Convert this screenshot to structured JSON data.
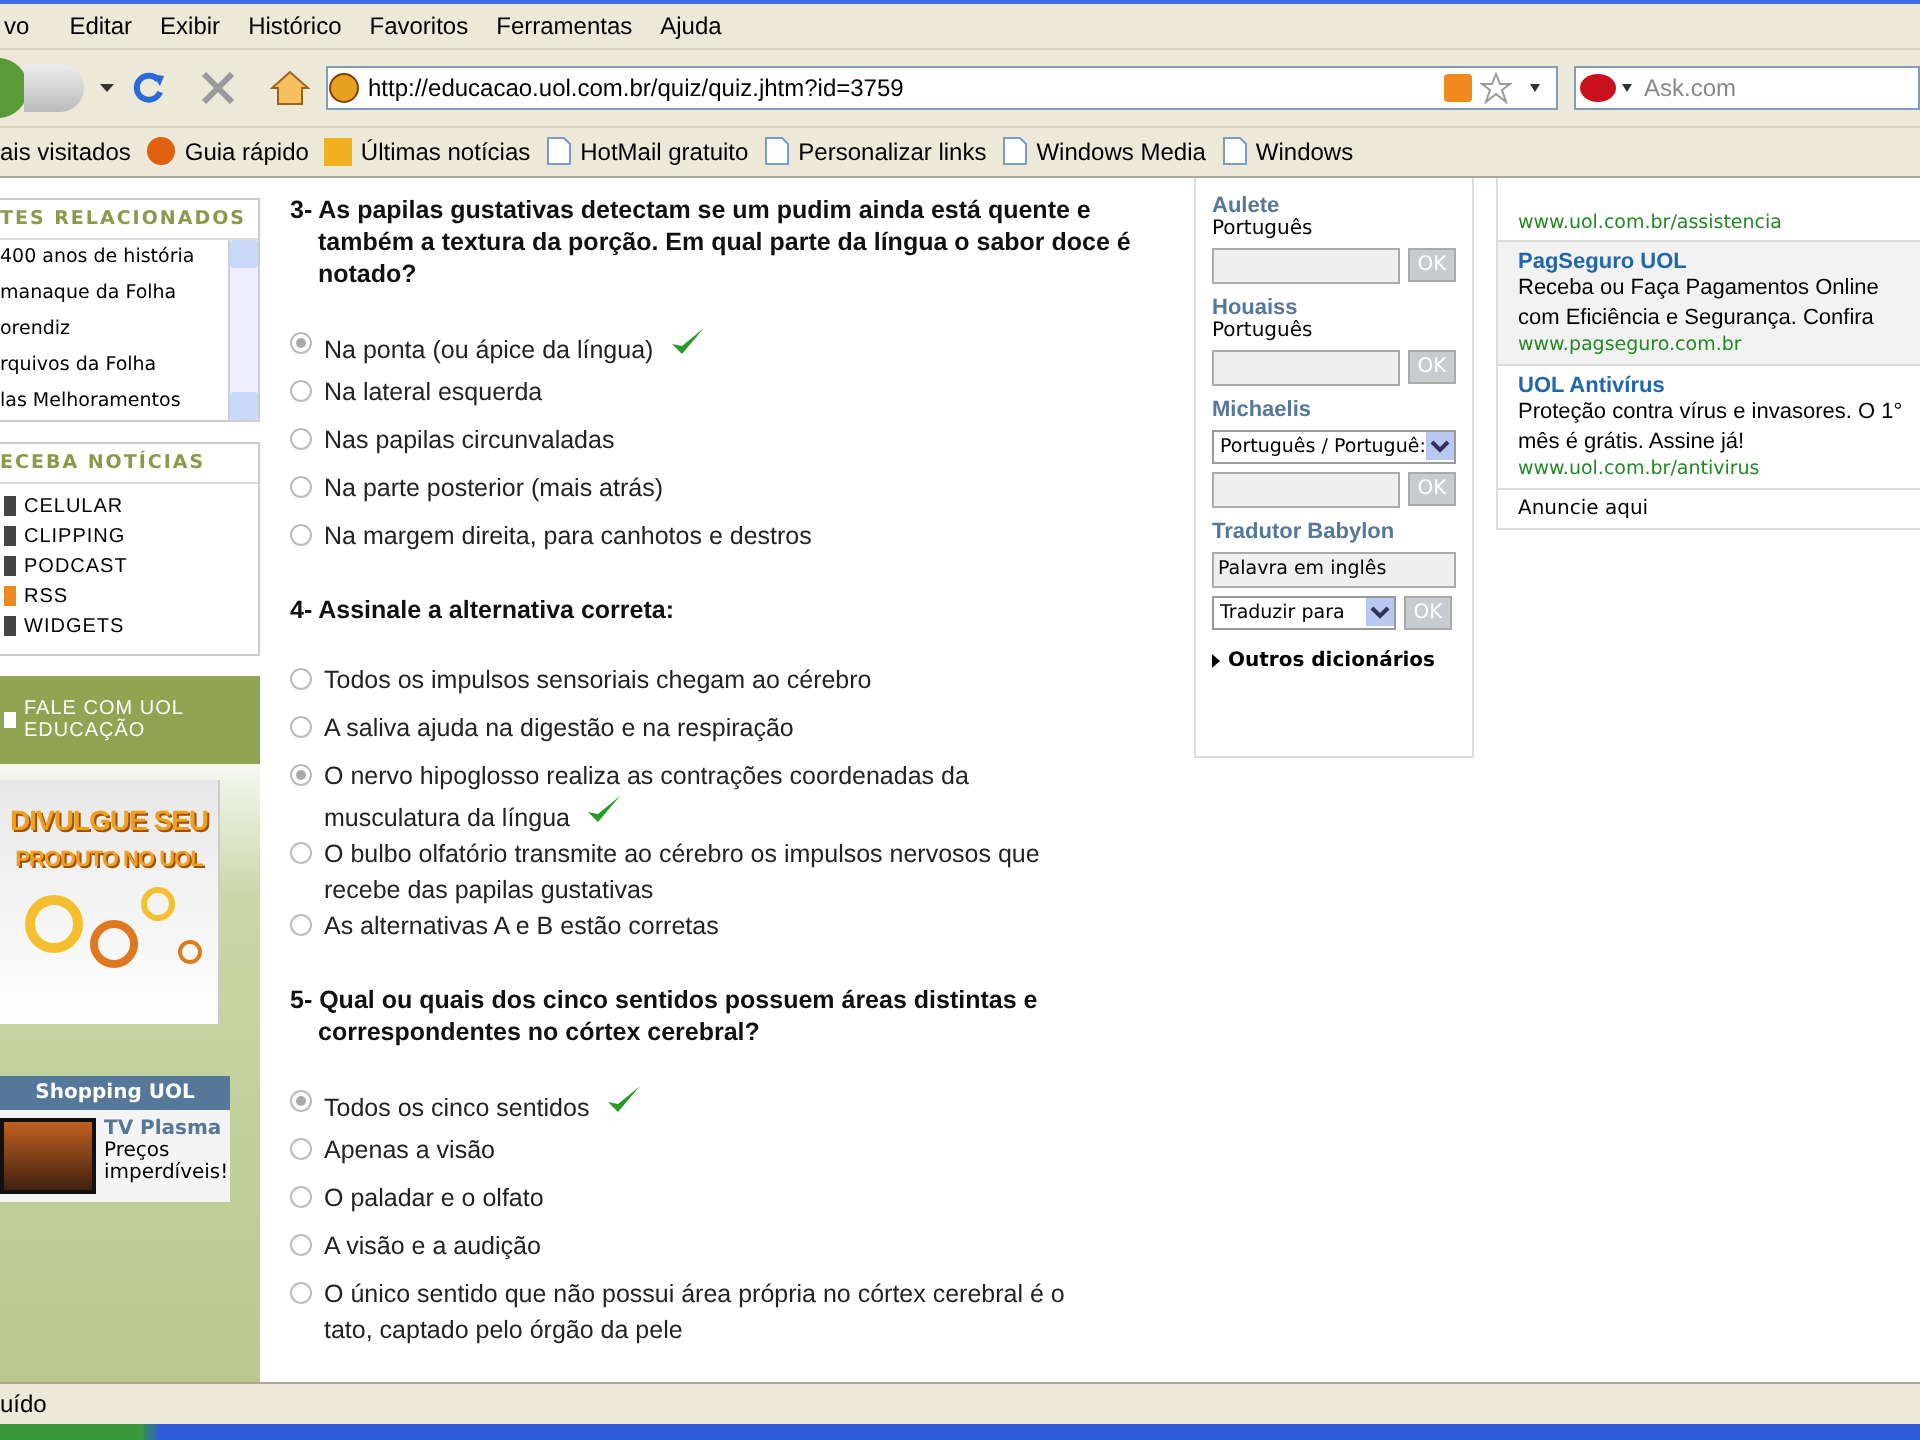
{
  "menu_bar": [
    "vo",
    "Editar",
    "Exibir",
    "Histórico",
    "Favoritos",
    "Ferramentas",
    "Ajuda"
  ],
  "nav_toolbar": {
    "url": "http://educacao.uol.com.br/quiz/quiz.jhtm?id=3759",
    "search_placeholder": "Ask.com"
  },
  "bookmarks": [
    "ais visitados",
    "Guia rápido",
    "Últimas notícias",
    "HotMail gratuito",
    "Personalizar links",
    "Windows Media",
    "Windows"
  ],
  "sidebar": {
    "related_title": "TES RELACIONADOS",
    "related": [
      "400 anos de história",
      "manaque da Folha",
      "orendiz",
      "rquivos da Folha",
      "las Melhoramentos"
    ],
    "news_title": "ECEBA NOTÍCIAS",
    "news": [
      "CELULAR",
      "CLIPPING",
      "PODCAST",
      "RSS",
      "WIDGETS"
    ],
    "contact": "FALE COM UOL EDUCAÇÃO",
    "banner": [
      "DIVULGUE SEU",
      "PRODUTO NO UOL"
    ],
    "shopping": {
      "title": "Shopping UOL",
      "product": "TV Plasma",
      "text": "Preços imperdíveis!"
    }
  },
  "questions": [
    {
      "title": "3- As papilas gustativas detectam se um pudim ainda está quente e também a textura da porção. Em qual parte da língua o sabor doce é notado?",
      "options": [
        {
          "text": "Na ponta (ou ápice da língua)",
          "selected": true,
          "correct": true
        },
        {
          "text": "Na lateral esquerda",
          "selected": false,
          "correct": false
        },
        {
          "text": "Nas papilas circunvaladas",
          "selected": false,
          "correct": false
        },
        {
          "text": "Na parte posterior (mais atrás)",
          "selected": false,
          "correct": false
        },
        {
          "text": "Na margem direita, para canhotos e destros",
          "selected": false,
          "correct": false
        }
      ]
    },
    {
      "title": "4- Assinale a alternativa correta:",
      "options": [
        {
          "text": "Todos os impulsos sensoriais chegam ao cérebro",
          "selected": false,
          "correct": false
        },
        {
          "text": "A saliva ajuda na digestão e na respiração",
          "selected": false,
          "correct": false
        },
        {
          "text": "O nervo hipoglosso realiza as contrações coordenadas da musculatura da língua",
          "selected": true,
          "correct": true
        },
        {
          "text": "O bulbo olfatório transmite ao cérebro os impulsos nervosos que recebe das papilas gustativas",
          "selected": false,
          "correct": false
        },
        {
          "text": "As alternativas A e B estão corretas",
          "selected": false,
          "correct": false
        }
      ]
    },
    {
      "title": "5- Qual ou quais dos cinco sentidos possuem áreas distintas e correspondentes no córtex cerebral?",
      "options": [
        {
          "text": "Todos os cinco sentidos",
          "selected": true,
          "correct": true
        },
        {
          "text": "Apenas a visão",
          "selected": false,
          "correct": false
        },
        {
          "text": "O paladar e o olfato",
          "selected": false,
          "correct": false
        },
        {
          "text": "A visão e a audição",
          "selected": false,
          "correct": false
        },
        {
          "text": "O único sentido que não possui área própria no córtex cerebral é o tato, captado pelo órgão da pele",
          "selected": false,
          "correct": false
        }
      ]
    }
  ],
  "dictionaries": [
    {
      "kind": "text",
      "name": "Aulete",
      "language": "Português",
      "button": "OK"
    },
    {
      "kind": "text",
      "name": "Houaiss",
      "language": "Português",
      "button": "OK"
    },
    {
      "kind": "select",
      "name": "Michaelis",
      "select": "Português / Portuguê:",
      "button": "OK"
    },
    {
      "kind": "translator",
      "name": "Tradutor Babylon",
      "input": "Palavra em inglês",
      "select": "Traduzir para",
      "button": "OK"
    }
  ],
  "more_dictionaries": "Outros dicionários",
  "ads": [
    {
      "title": "PagSeguro UOL",
      "text": "Receba ou Faça Pagamentos Online com Eficiência e Segurança. Confira",
      "url": "www.pagseguro.com.br",
      "highlighted": true
    },
    {
      "title": "UOL Antivírus",
      "text": "Proteção contra vírus e invasores. O 1° mês é grátis. Assine já!",
      "url": "www.uol.com.br/antivirus",
      "highlighted": false
    }
  ],
  "ad_top_url": "www.uol.com.br/assistencia",
  "advertise": "Anuncie aqui",
  "status_bar": "uído"
}
